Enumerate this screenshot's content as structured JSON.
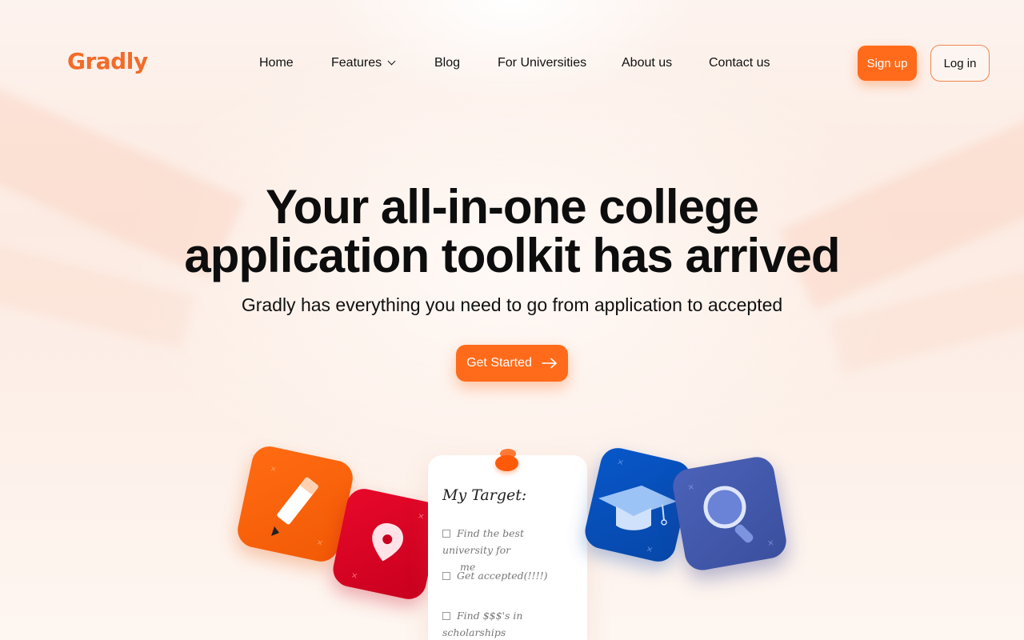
{
  "brand": {
    "logo": "Gradly",
    "accent": "#ff6b1a"
  },
  "nav": {
    "items": [
      {
        "label": "Home"
      },
      {
        "label": "Features",
        "has_dropdown": true,
        "icon": "chevron-down-icon"
      },
      {
        "label": "Blog"
      },
      {
        "label": "For Universities"
      },
      {
        "label": "About us"
      },
      {
        "label": "Contact us"
      }
    ]
  },
  "auth": {
    "signup": "Sign up",
    "login": "Log in"
  },
  "hero": {
    "title_line1": "Your all-in-one college",
    "title_line2": "application toolkit has arrived",
    "subtitle": "Gradly has everything you need to go from application to accepted",
    "cta": "Get Started",
    "cta_icon": "arrow-right-icon"
  },
  "illustration": {
    "note_title": "My Target:",
    "checklist": [
      {
        "line1": "Find the best university for",
        "line2": "me"
      },
      {
        "line1": "Get accepted(!!!!)"
      },
      {
        "line1": "Find $$$'s in scholarships"
      }
    ],
    "tiles": [
      "pencil-icon",
      "map-pin-icon",
      "graduation-cap-icon",
      "magnifier-icon"
    ]
  }
}
